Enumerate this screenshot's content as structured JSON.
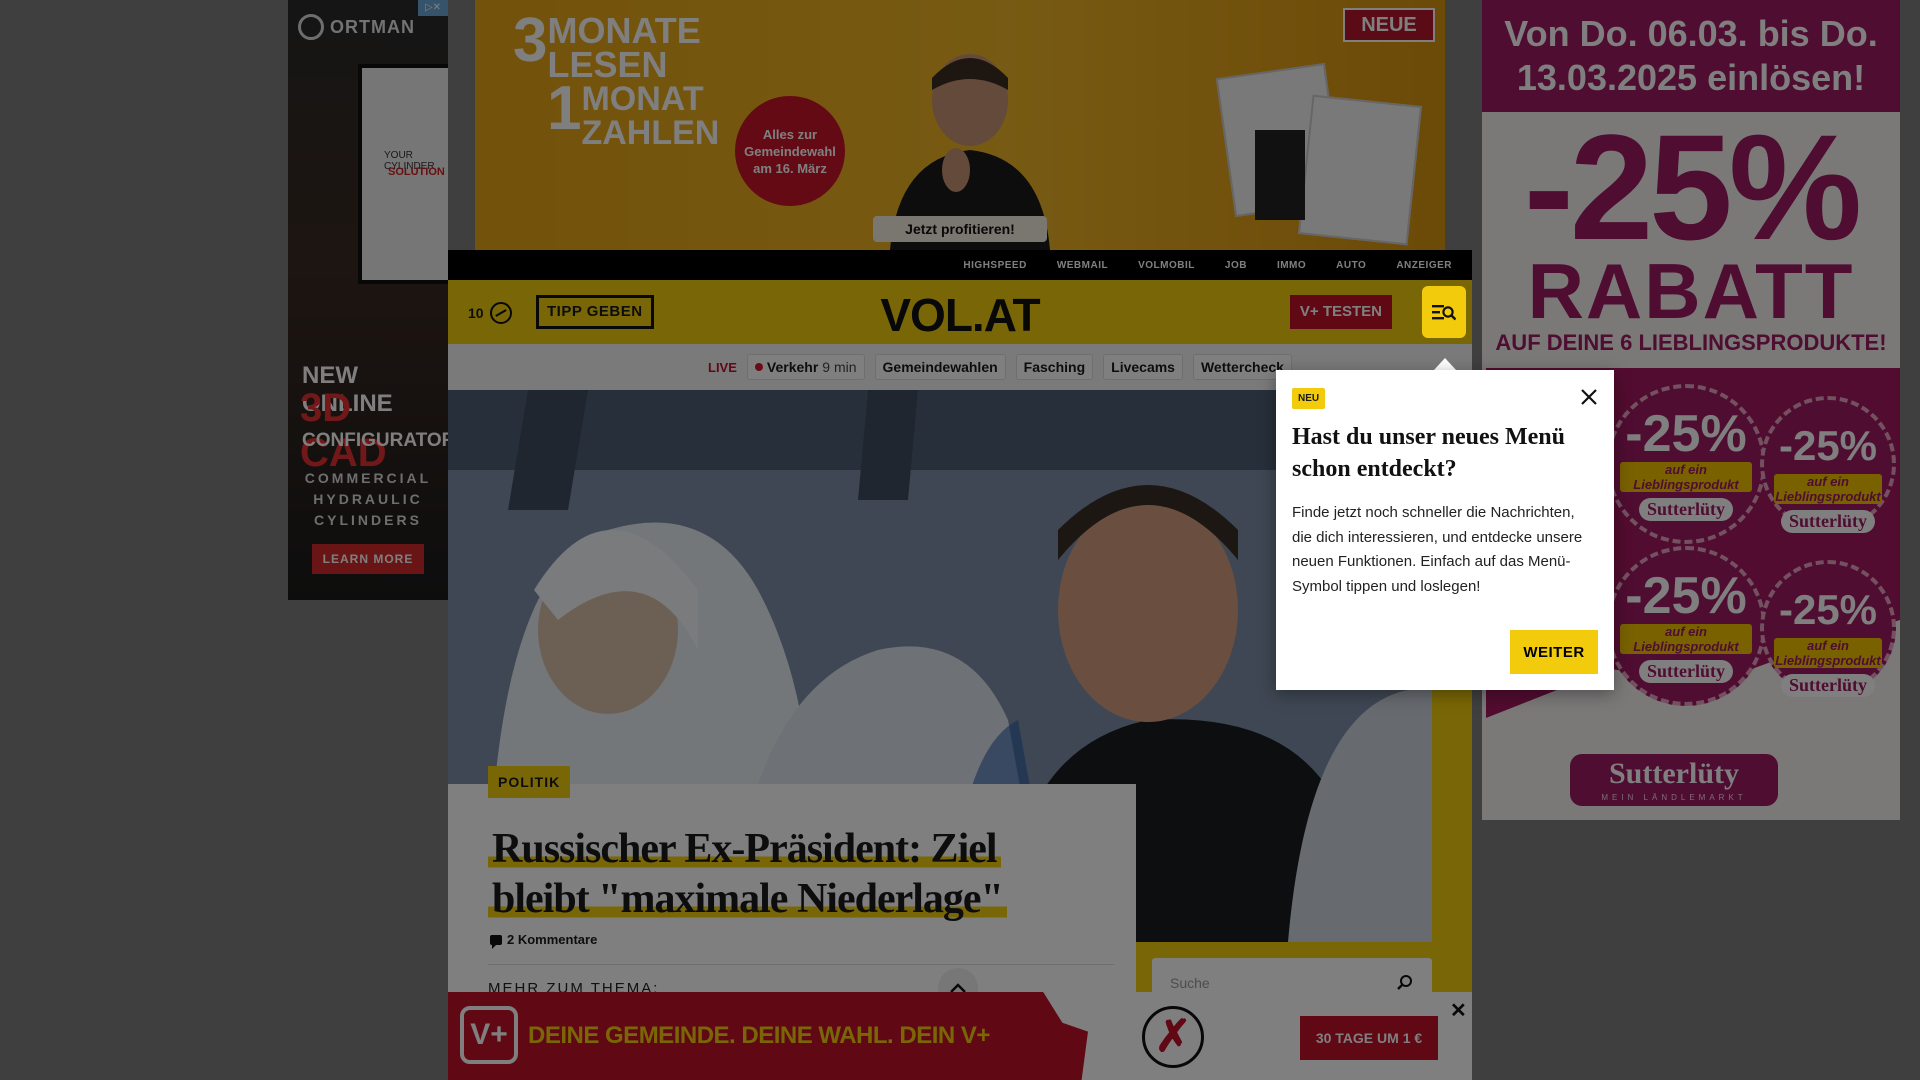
{
  "ads": {
    "ortman": {
      "brand": "ORTMAN",
      "screen_line1": "YOUR CYLINDER",
      "screen_line2": "SOLUTION",
      "line1": "NEW ONLINE",
      "line2": "3D CAD",
      "line3": "CONFIGURATOR",
      "line4": "COMMERCIAL HYDRAULIC CYLINDERS",
      "cta": "LEARN MORE"
    },
    "neue": {
      "headline_num1": "3",
      "headline_1": "MONATE LESEN",
      "headline_num2": "1",
      "headline_2": "MONAT ZAHLEN",
      "badge": "Alles zur Gemeindewahl am 16. März",
      "cta": "Jetzt profitieren!",
      "logo": "NEUE"
    },
    "sutterluety": {
      "dates": "Von Do. 06.03. bis Do. 13.03.2025 einlösen!",
      "percent": "-25%",
      "rabatt": "RABATT",
      "sub": "AUF DEINE 6 LIEBLINGSPRODUKTE!",
      "sticker_pct": "-25%",
      "sticker_text": "auf ein Lieblingsprodukt",
      "sticker_brand": "Sutterlüty",
      "logo": "Sutterlüty",
      "logo_sub": "MEIN LÄNDLEMARKT"
    }
  },
  "site": {
    "topnav": [
      "HIGHSPEED",
      "WEBMAIL",
      "VOLMOBIL",
      "JOB",
      "IMMO",
      "AUTO",
      "ANZEIGER"
    ],
    "weather_temp": "10",
    "tipp_label": "TIPP GEBEN",
    "logo": "VOL.AT",
    "vplus_label": "V+ TESTEN",
    "subnav": {
      "live": "LIVE",
      "traffic_label": "Verkehr",
      "traffic_time": "9 min",
      "chips": [
        "Gemeindewahlen",
        "Fasching",
        "Livecams",
        "Wettercheck"
      ]
    },
    "article": {
      "category": "POLITIK",
      "headline_1": "Russischer Ex-Präsident: Ziel",
      "headline_2": "bleibt \"maximale Niederlage\"",
      "comments": "2 Kommentare",
      "more_topic": "MEHR ZUM THEMA:"
    },
    "search_placeholder": "Suche"
  },
  "popup": {
    "badge": "NEU",
    "title": "Hast du unser neues Menü schon entdeckt?",
    "body": "Finde jetzt noch schneller die Nachrichten, die dich interessieren, und entdecke unsere neuen Funktionen. Einfach auf das Menü-Symbol tippen und loslegen!",
    "button": "WEITER"
  },
  "vbanner": {
    "icon": "V+",
    "text": "DEINE GEMEINDE. DEINE WAHL. DEIN V+",
    "cta": "30 TAGE UM 1 €",
    "close": "✕"
  },
  "colors": {
    "brand_yellow": "#f2cc0c",
    "brand_red": "#c3112a",
    "sutterluety_purple": "#9e1b62"
  }
}
